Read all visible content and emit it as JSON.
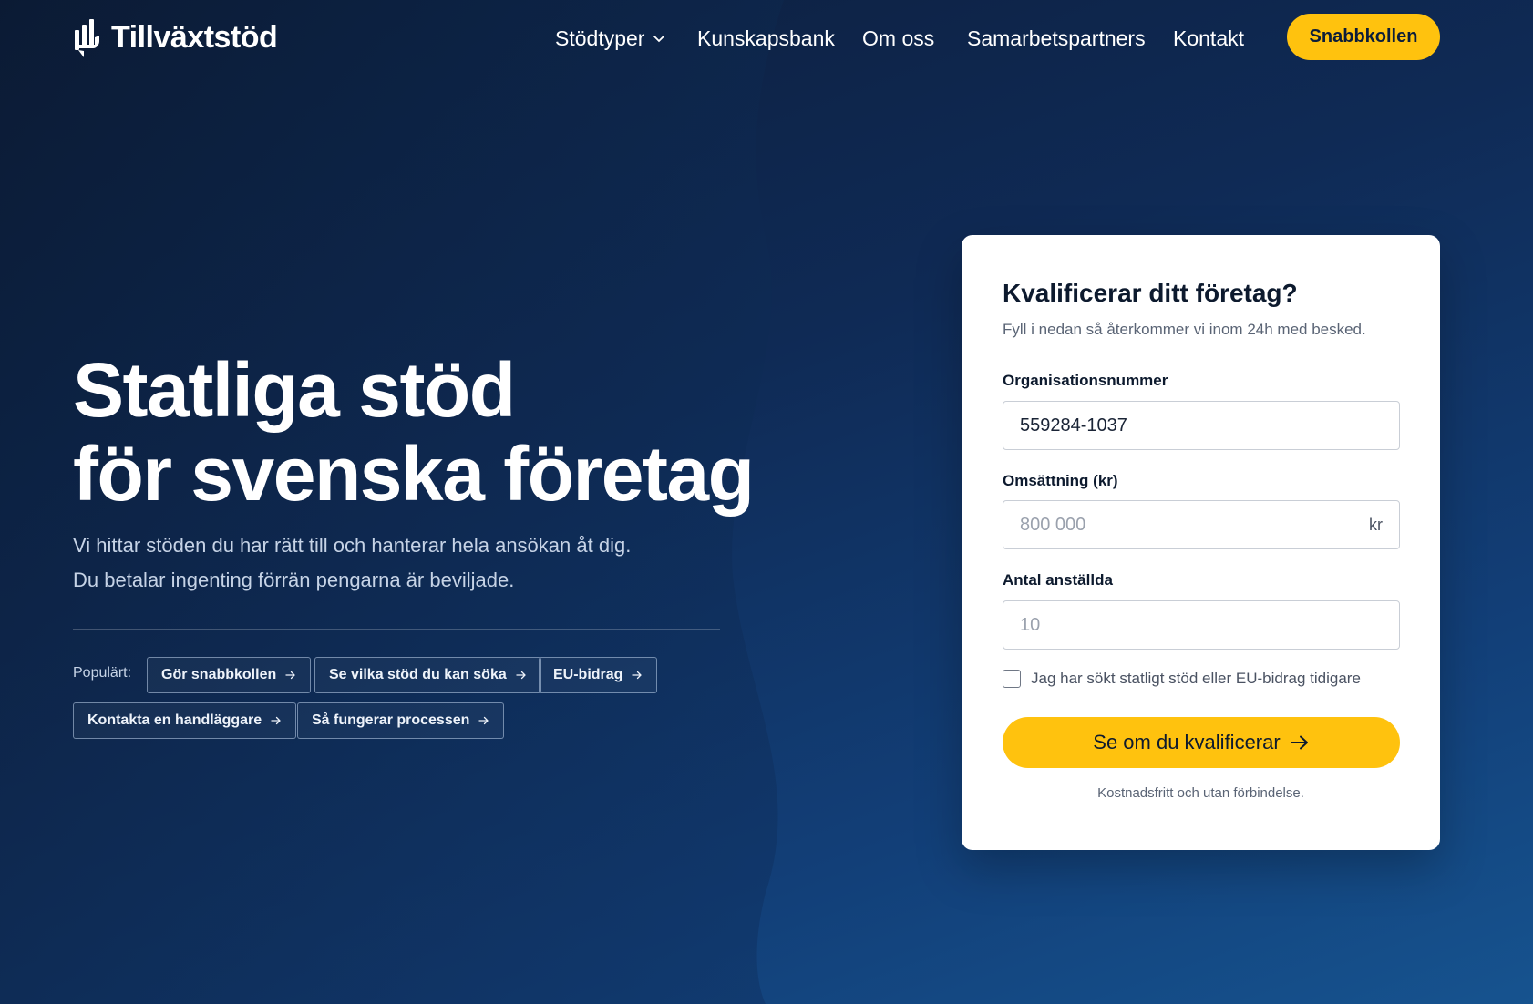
{
  "brand": {
    "name": "Tillväxtstöd",
    "logo_icon": "bar-chart-hand-icon"
  },
  "nav": {
    "items": [
      {
        "label": "Stödtyper",
        "has_dropdown": true
      },
      {
        "label": "Kunskapsbank"
      },
      {
        "label": "Om oss"
      },
      {
        "label": "Samarbetspartners"
      },
      {
        "label": "Kontakt"
      }
    ],
    "cta_label": "Snabbkollen"
  },
  "hero": {
    "title_line1": "Statliga stöd",
    "title_line2": "för svenska företag",
    "subtitle": "Vi hittar stöden du har rätt till och hanterar hela ansökan åt dig. Du betalar ingenting förrän pengarna är beviljade.",
    "popular_label": "Populärt:",
    "chips": [
      "Gör snabbkollen",
      "Se vilka stöd du kan söka",
      "EU-bidrag",
      "Kontakta en handläggare",
      "Så fungerar processen"
    ]
  },
  "form": {
    "title": "Kvalificerar ditt företag?",
    "subtitle": "Fyll i nedan så återkommer vi inom 24h med besked.",
    "org_label": "Organisationsnummer",
    "org_value": "559284-1037",
    "revenue_label": "Omsättning (kr)",
    "revenue_placeholder": "800 000",
    "revenue_suffix": "kr",
    "employees_label": "Antal anställda",
    "employees_placeholder": "10",
    "checkbox_label": "Jag har sökt statligt stöd eller EU-bidrag tidigare",
    "checkbox_checked": false,
    "submit_label": "Se om du kvalificerar",
    "footnote": "Kostnadsfritt och utan förbindelse."
  },
  "colors": {
    "accent": "#ffc20e",
    "background_dark": "#0c1d3a",
    "background_light": "#16538f",
    "card": "#ffffff"
  }
}
